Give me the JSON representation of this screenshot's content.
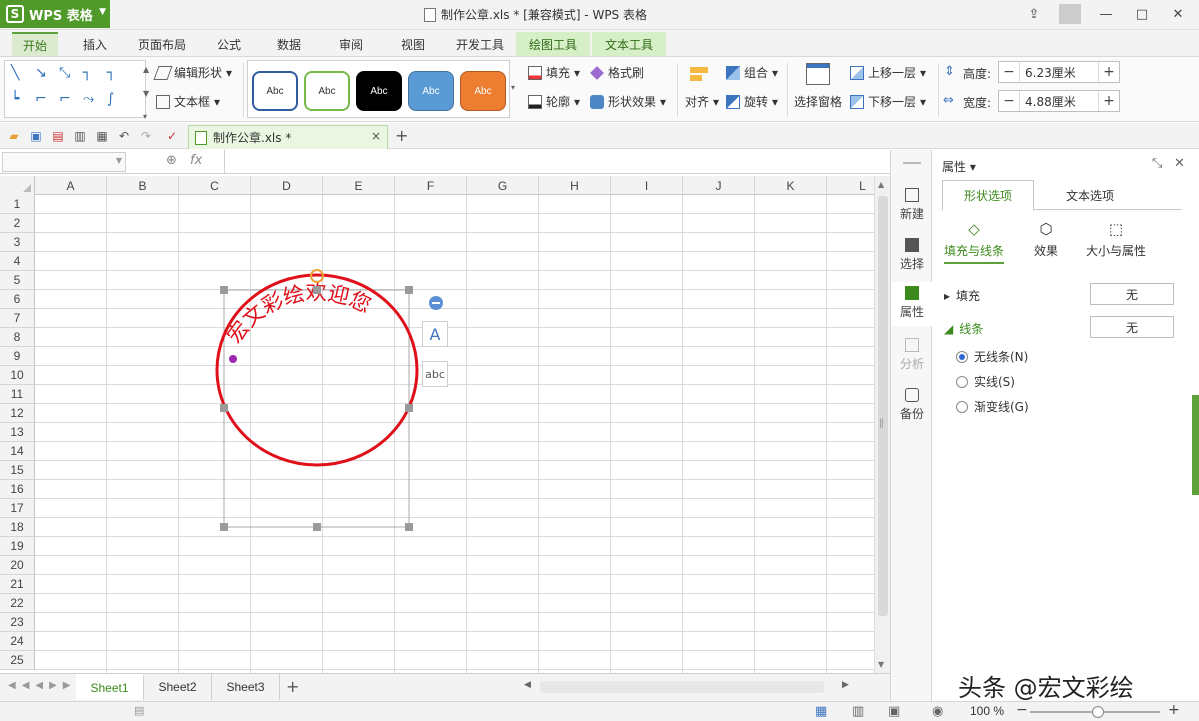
{
  "titlebar": {
    "app_label": "WPS 表格",
    "doc_title": "制作公章.xls * [兼容模式] - WPS 表格"
  },
  "ribbon_tabs": [
    "开始",
    "插入",
    "页面布局",
    "公式",
    "数据",
    "审阅",
    "视图",
    "开发工具",
    "绘图工具",
    "文本工具"
  ],
  "ribbon": {
    "edit_shape": "编辑形状",
    "text_box": "文本框",
    "style_label": "Abc",
    "fill": "填充",
    "format_painter": "格式刷",
    "outline": "轮廓",
    "shape_effect": "形状效果",
    "align": "对齐",
    "group": "组合",
    "rotate": "旋转",
    "selection_pane": "选择窗格",
    "bring_forward": "上移一层",
    "send_backward": "下移一层",
    "height_label": "高度:",
    "height_value": "6.23厘米",
    "width_label": "宽度:",
    "width_value": "4.88厘米",
    "plus": "+",
    "minus": "−"
  },
  "doc_tab": {
    "label": "制作公章.xls *",
    "close": "×",
    "plus": "+"
  },
  "formula_bar": {
    "fx": "fx"
  },
  "columns": [
    "A",
    "B",
    "C",
    "D",
    "E",
    "F",
    "G",
    "H",
    "I",
    "J",
    "K",
    "L"
  ],
  "rows": [
    "1",
    "2",
    "3",
    "4",
    "5",
    "6",
    "7",
    "8",
    "9",
    "10",
    "11",
    "12",
    "13",
    "14",
    "15",
    "16",
    "17",
    "18",
    "19",
    "20",
    "21",
    "22",
    "23",
    "24",
    "25"
  ],
  "stamp": {
    "arc_text": "宏文彩绘欢迎您",
    "color": "#e0101a"
  },
  "float_buttons": {
    "text_a": "A",
    "abc": "abc"
  },
  "sheets": [
    "Sheet1",
    "Sheet2",
    "Sheet3"
  ],
  "sheet_plus": "+",
  "status": {
    "zoom": "100 %",
    "minus": "−",
    "plus": "+"
  },
  "side_strip": [
    "新建",
    "选择",
    "属性",
    "分析",
    "备份"
  ],
  "properties": {
    "title": "属性 ▾",
    "tabs": [
      "形状选项",
      "文本选项"
    ],
    "subtabs": [
      "填充与线条",
      "效果",
      "大小与属性"
    ],
    "fill_label": "填充",
    "fill_value": "无",
    "line_label": "线条",
    "line_value": "无",
    "radios": [
      "无线条(N)",
      "实线(S)",
      "渐变线(G)"
    ]
  },
  "watermark": "头条 @宏文彩绘",
  "colors": {
    "accent_green": "#5ea03a",
    "stamp_red": "#e0101a"
  }
}
